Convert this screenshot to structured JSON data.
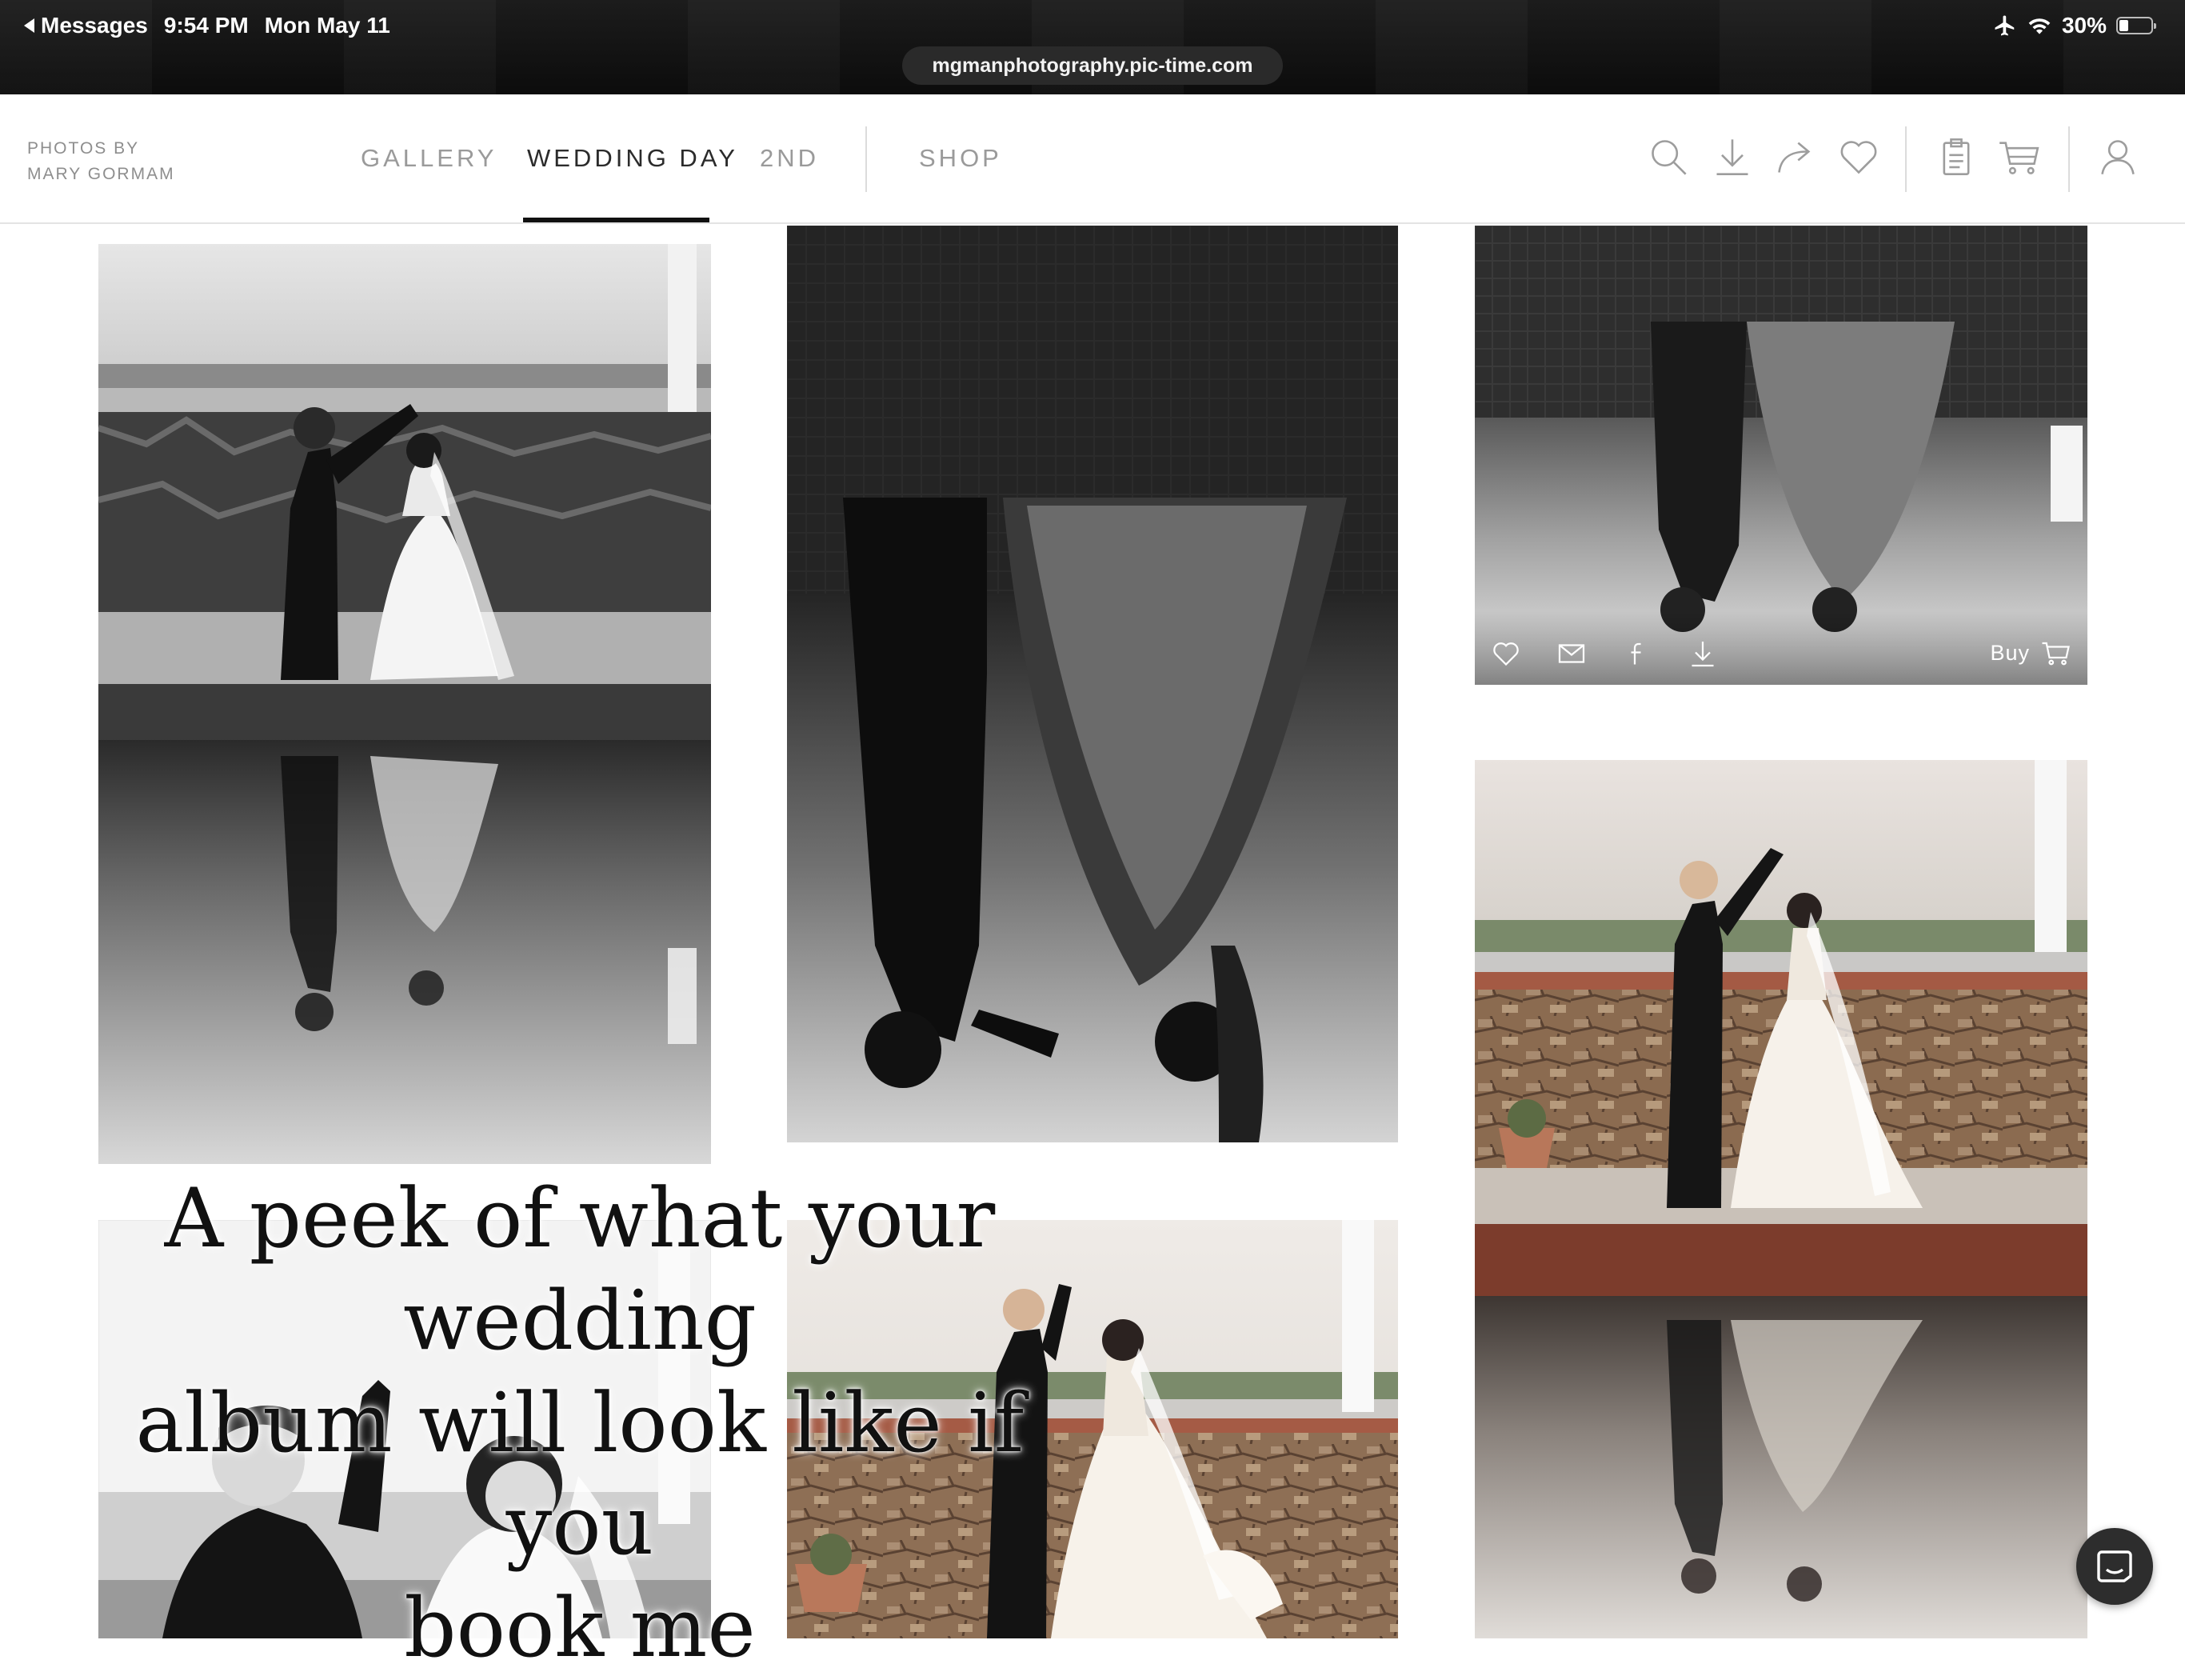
{
  "status_bar": {
    "back_label": "Messages",
    "time": "9:54 PM",
    "date": "Mon May 11",
    "battery": "30%",
    "battery_level": 0.3
  },
  "browser": {
    "url": "mgmanphotography.pic-time.com"
  },
  "header": {
    "brand_line1": "PHOTOS BY",
    "brand_line2": "MARY GORMAM",
    "nav": [
      {
        "label": "GALLERY",
        "active": false
      },
      {
        "label": "WEDDING DAY",
        "active": true
      },
      {
        "label": "2ND",
        "active": false
      },
      {
        "label": "SHOP",
        "active": false
      }
    ],
    "tools": [
      "search-icon",
      "download-icon",
      "share-icon",
      "heart-icon",
      "clipboard-icon",
      "cart-icon",
      "account-icon"
    ]
  },
  "photo_overlay": {
    "icons": [
      "heart-icon",
      "mail-icon",
      "facebook-icon",
      "download-icon"
    ],
    "buy_label": "Buy"
  },
  "caption": {
    "line1": "A peek of what your wedding",
    "line2": "album will look like if you",
    "line3": "book me"
  },
  "chat": {
    "icon": "chat-icon"
  }
}
